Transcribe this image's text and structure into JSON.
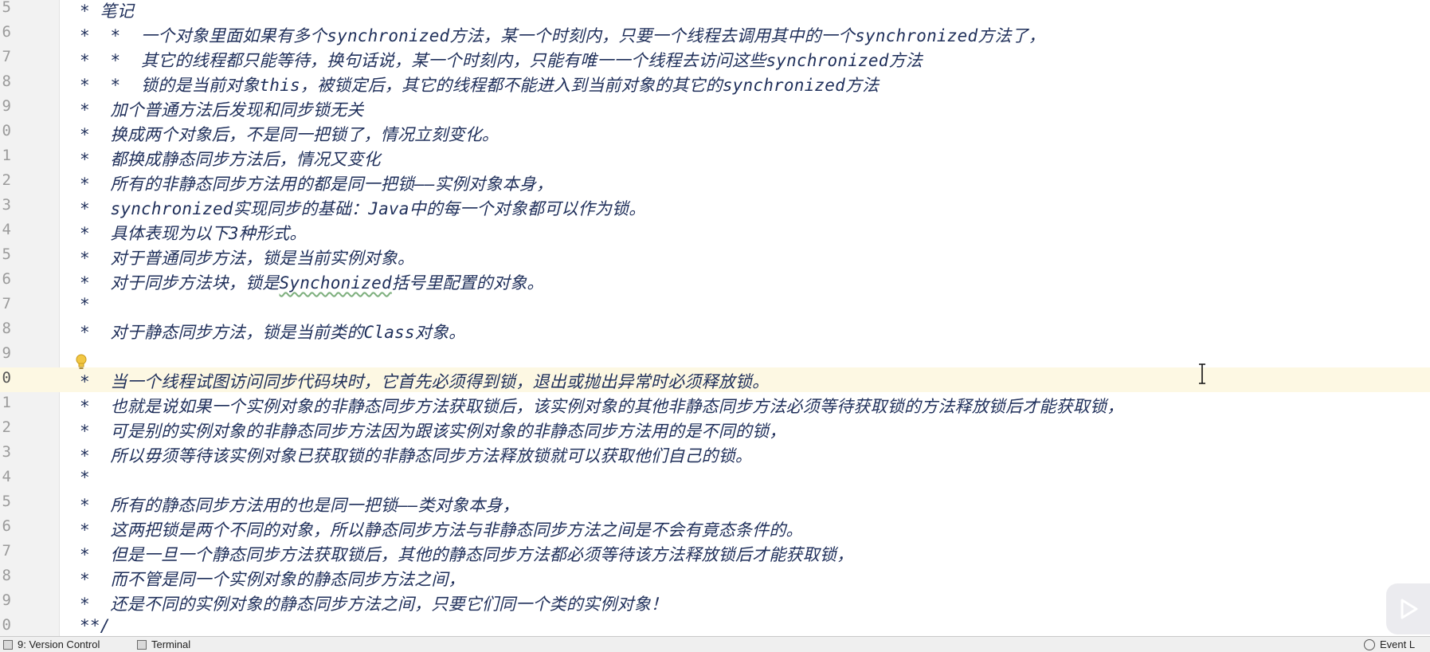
{
  "editor": {
    "current_line_number": "0",
    "lines": [
      {
        "num": "5",
        "text": "* 笔记",
        "current": false
      },
      {
        "num": "6",
        "text": "*  *  一个对象里面如果有多个synchronized方法，某一个时刻内，只要一个线程去调用其中的一个synchronized方法了，",
        "current": false
      },
      {
        "num": "7",
        "text": "*  *  其它的线程都只能等待，换句话说，某一个时刻内，只能有唯一一个线程去访问这些synchronized方法",
        "current": false
      },
      {
        "num": "8",
        "text": "*  *  锁的是当前对象this，被锁定后，其它的线程都不能进入到当前对象的其它的synchronized方法",
        "current": false
      },
      {
        "num": "9",
        "text": "*  加个普通方法后发现和同步锁无关",
        "current": false
      },
      {
        "num": "0",
        "text": "*  换成两个对象后，不是同一把锁了，情况立刻变化。",
        "current": false
      },
      {
        "num": "1",
        "text": "*  都换成静态同步方法后，情况又变化",
        "current": false
      },
      {
        "num": "2",
        "text": "*  所有的非静态同步方法用的都是同一把锁——实例对象本身，",
        "current": false
      },
      {
        "num": "3",
        "text": "*  synchronized实现同步的基础：Java中的每一个对象都可以作为锁。",
        "current": false
      },
      {
        "num": "4",
        "text": "*  具体表现为以下3种形式。",
        "current": false
      },
      {
        "num": "5",
        "text": "*  对于普通同步方法，锁是当前实例对象。",
        "current": false
      },
      {
        "num": "6",
        "text": "*  对于同步方法块，锁是Synchonized括号里配置的对象。",
        "current": false
      },
      {
        "num": "7",
        "text": "*",
        "current": false
      },
      {
        "num": "8",
        "text": "*  对于静态同步方法，锁是当前类的Class对象。",
        "current": false
      },
      {
        "num": "9",
        "text": "",
        "current": false
      },
      {
        "num": "0",
        "text": "*  当一个线程试图访问同步代码块时，它首先必须得到锁，退出或抛出异常时必须释放锁。",
        "current": true
      },
      {
        "num": "1",
        "text": "*  也就是说如果一个实例对象的非静态同步方法获取锁后，该实例对象的其他非静态同步方法必须等待获取锁的方法释放锁后才能获取锁，",
        "current": false
      },
      {
        "num": "2",
        "text": "*  可是别的实例对象的非静态同步方法因为跟该实例对象的非静态同步方法用的是不同的锁，",
        "current": false
      },
      {
        "num": "3",
        "text": "*  所以毋须等待该实例对象已获取锁的非静态同步方法释放锁就可以获取他们自己的锁。",
        "current": false
      },
      {
        "num": "4",
        "text": "*",
        "current": false
      },
      {
        "num": "5",
        "text": "*  所有的静态同步方法用的也是同一把锁——类对象本身，",
        "current": false
      },
      {
        "num": "6",
        "text": "*  这两把锁是两个不同的对象，所以静态同步方法与非静态同步方法之间是不会有竟态条件的。",
        "current": false
      },
      {
        "num": "7",
        "text": "*  但是一旦一个静态同步方法获取锁后，其他的静态同步方法都必须等待该方法释放锁后才能获取锁，",
        "current": false
      },
      {
        "num": "8",
        "text": "*  而不管是同一个实例对象的静态同步方法之间，",
        "current": false
      },
      {
        "num": "9",
        "text": "*  还是不同的实例对象的静态同步方法之间，只要它们同一个类的实例对象！",
        "current": false
      },
      {
        "num": "0",
        "text": "**/",
        "current": false
      }
    ]
  },
  "statusbar": {
    "version_control": "9: Version Control",
    "terminal": "Terminal",
    "event_log": "Event L"
  },
  "icons": {
    "intention": "lightbulb-icon",
    "cursor": "text-cursor-icon",
    "video": "play-icon"
  },
  "colors": {
    "comment_text": "#1f2f5a",
    "current_line_bg": "#fdf8e3",
    "gutter_bg": "#f2f2f2"
  }
}
